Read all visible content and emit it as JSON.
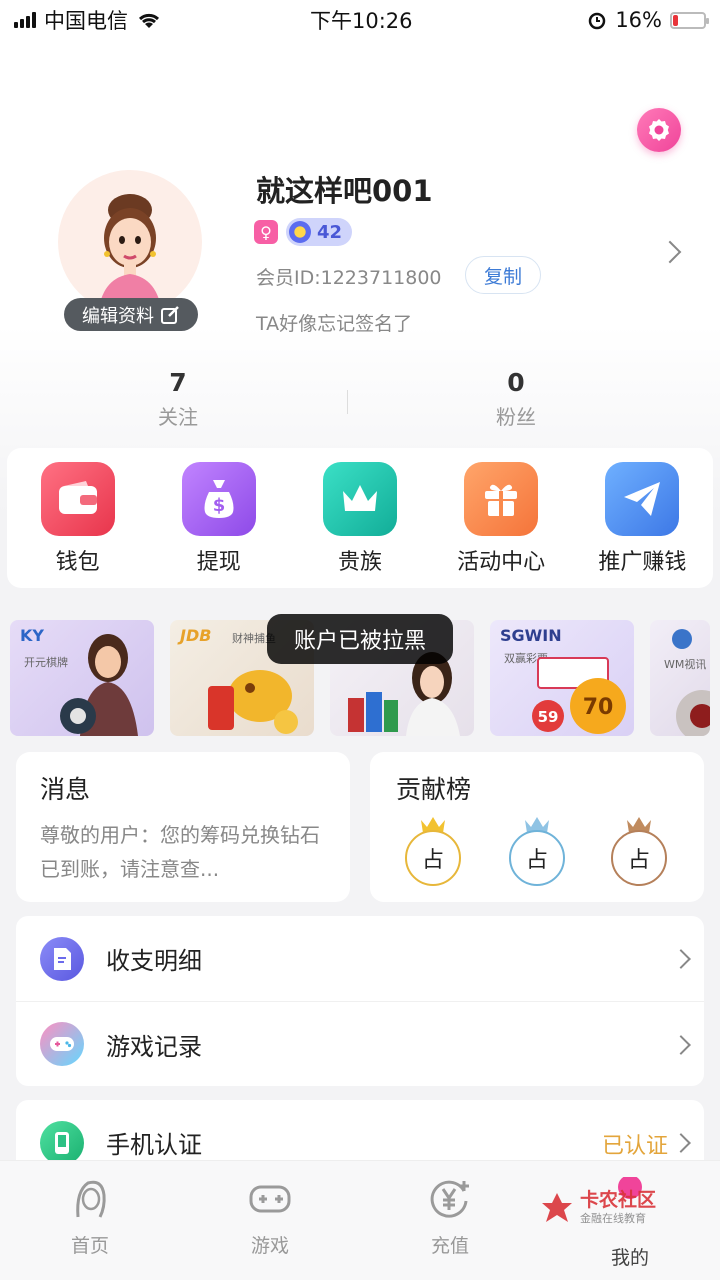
{
  "status_bar": {
    "carrier": "中国电信",
    "time": "下午10:26",
    "battery": "16%",
    "battery_level": 0.16
  },
  "profile": {
    "username": "就这样吧001",
    "gender_symbol": "♀",
    "level": "42",
    "member_id": "会员ID:1223711800",
    "copy_label": "复制",
    "signature": "TA好像忘记签名了",
    "edit_label": "编辑资料"
  },
  "stats": [
    {
      "value": "7",
      "label": "关注"
    },
    {
      "value": "0",
      "label": "粉丝"
    }
  ],
  "quick_menu": [
    {
      "label": "钱包",
      "icon": "wallet-icon",
      "color": "#f04d5f"
    },
    {
      "label": "提现",
      "icon": "money-bag-icon",
      "color": "#a35ff0"
    },
    {
      "label": "贵族",
      "icon": "crown-icon",
      "color": "#1fc4b0"
    },
    {
      "label": "活动中心",
      "icon": "gift-icon",
      "color": "#f98a4d"
    },
    {
      "label": "推广赚钱",
      "icon": "paper-plane-icon",
      "color": "#4f8ef2"
    }
  ],
  "banners": [
    {
      "logo": "KY",
      "sub": "开元棋牌"
    },
    {
      "logo": "JDB",
      "sub": "财神捕鱼"
    },
    {
      "logo": "",
      "sub": ""
    },
    {
      "logo": "SGWIN",
      "sub": "双赢彩票"
    },
    {
      "logo": "",
      "sub": "WM视讯"
    }
  ],
  "toast": "账户已被拉黑",
  "messages": {
    "title": "消息",
    "body": "尊敬的用户：您的筹码兑换钻石已到账，请注意查..."
  },
  "leaderboard": {
    "title": "贡献榜",
    "slots": [
      {
        "text": "占",
        "color": "#e7b73a"
      },
      {
        "text": "占",
        "color": "#6fb3d9"
      },
      {
        "text": "占",
        "color": "#b5805a"
      }
    ]
  },
  "menu_list": [
    {
      "label": "收支明细",
      "icon": "document-icon",
      "value": ""
    },
    {
      "label": "游戏记录",
      "icon": "gamepad-icon",
      "value": ""
    }
  ],
  "phone_row": {
    "label": "手机认证",
    "icon": "phone-icon",
    "value": "已认证"
  },
  "tabs": [
    {
      "label": "首页",
      "icon": "lady-icon"
    },
    {
      "label": "游戏",
      "icon": "gamepad-icon"
    },
    {
      "label": "充值",
      "icon": "yen-icon"
    },
    {
      "label": "我的",
      "icon": "profile-icon"
    }
  ],
  "watermark": {
    "title": "卡农社区",
    "sub": "金融在线教育"
  }
}
